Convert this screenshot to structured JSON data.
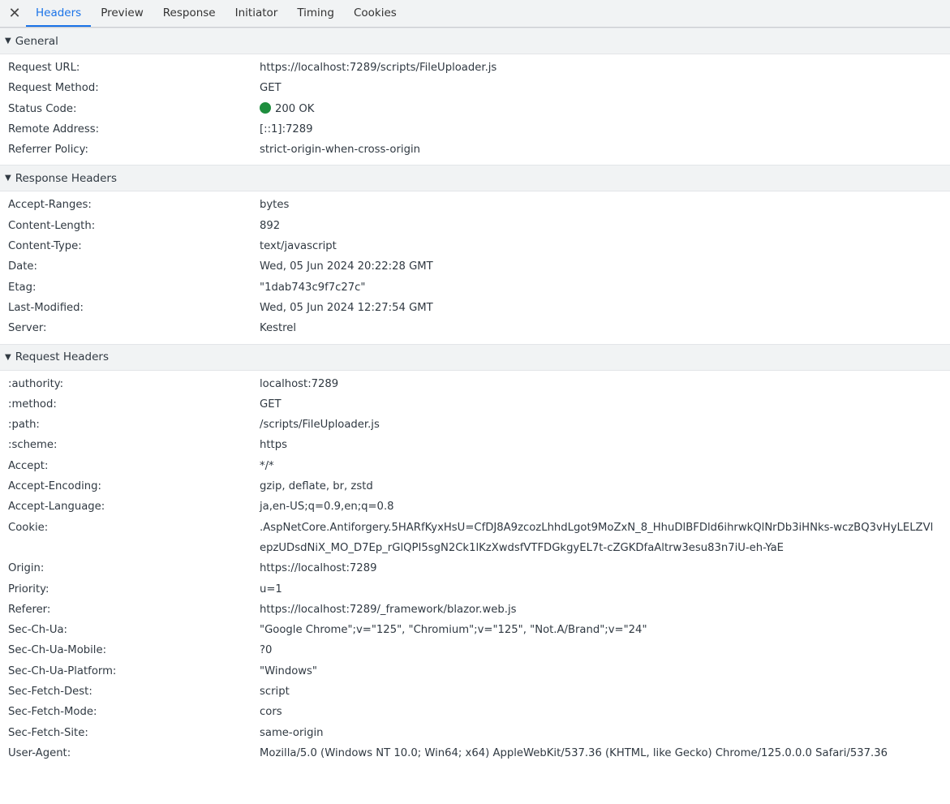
{
  "tabs": {
    "close_icon": "close-icon",
    "items": [
      "Headers",
      "Preview",
      "Response",
      "Initiator",
      "Timing",
      "Cookies"
    ],
    "active": "Headers"
  },
  "general": {
    "title": "General",
    "rows": [
      {
        "key": "Request URL:",
        "value": "https://localhost:7289/scripts/FileUploader.js"
      },
      {
        "key": "Request Method:",
        "value": "GET"
      },
      {
        "key": "Status Code:",
        "value": "200 OK"
      },
      {
        "key": "Remote Address:",
        "value": "[::1]:7289"
      },
      {
        "key": "Referrer Policy:",
        "value": "strict-origin-when-cross-origin"
      }
    ],
    "status_color": "#1e8e3e"
  },
  "response_headers": {
    "title": "Response Headers",
    "rows": [
      {
        "key": "Accept-Ranges:",
        "value": "bytes"
      },
      {
        "key": "Content-Length:",
        "value": "892"
      },
      {
        "key": "Content-Type:",
        "value": "text/javascript"
      },
      {
        "key": "Date:",
        "value": "Wed, 05 Jun 2024 20:22:28 GMT"
      },
      {
        "key": "Etag:",
        "value": "\"1dab743c9f7c27c\""
      },
      {
        "key": "Last-Modified:",
        "value": "Wed, 05 Jun 2024 12:27:54 GMT"
      },
      {
        "key": "Server:",
        "value": "Kestrel"
      }
    ]
  },
  "request_headers": {
    "title": "Request Headers",
    "rows": [
      {
        "key": ":authority:",
        "value": "localhost:7289"
      },
      {
        "key": ":method:",
        "value": "GET"
      },
      {
        "key": ":path:",
        "value": "/scripts/FileUploader.js"
      },
      {
        "key": ":scheme:",
        "value": "https"
      },
      {
        "key": "Accept:",
        "value": "*/*"
      },
      {
        "key": "Accept-Encoding:",
        "value": "gzip, deflate, br, zstd"
      },
      {
        "key": "Accept-Language:",
        "value": "ja,en-US;q=0.9,en;q=0.8"
      },
      {
        "key": "Cookie:",
        "value": ".AspNetCore.Antiforgery.5HARfKyxHsU=CfDJ8A9zcozLhhdLgot9MoZxN_8_HhuDlBFDld6ihrwkQlNrDb3iHNks-wczBQ3vHyLELZVlepzUDsdNiX_MO_D7Ep_rGlQPI5sgN2Ck1lKzXwdsfVTFDGkgyEL7t-cZGKDfaAltrw3esu83n7iU-eh-YaE"
      },
      {
        "key": "Origin:",
        "value": "https://localhost:7289"
      },
      {
        "key": "Priority:",
        "value": "u=1"
      },
      {
        "key": "Referer:",
        "value": "https://localhost:7289/_framework/blazor.web.js"
      },
      {
        "key": "Sec-Ch-Ua:",
        "value": "\"Google Chrome\";v=\"125\", \"Chromium\";v=\"125\", \"Not.A/Brand\";v=\"24\""
      },
      {
        "key": "Sec-Ch-Ua-Mobile:",
        "value": "?0"
      },
      {
        "key": "Sec-Ch-Ua-Platform:",
        "value": "\"Windows\""
      },
      {
        "key": "Sec-Fetch-Dest:",
        "value": "script"
      },
      {
        "key": "Sec-Fetch-Mode:",
        "value": "cors"
      },
      {
        "key": "Sec-Fetch-Site:",
        "value": "same-origin"
      },
      {
        "key": "User-Agent:",
        "value": "Mozilla/5.0 (Windows NT 10.0; Win64; x64) AppleWebKit/537.36 (KHTML, like Gecko) Chrome/125.0.0.0 Safari/537.36"
      }
    ]
  }
}
